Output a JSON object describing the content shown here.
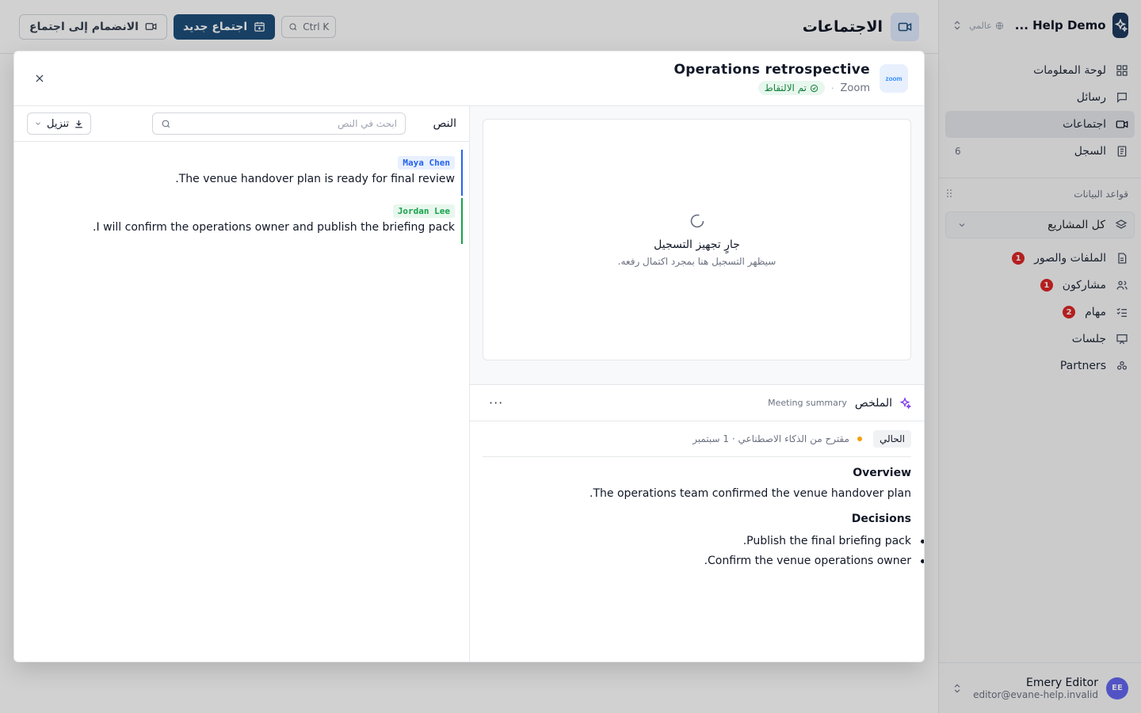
{
  "workspace": {
    "name": "Help Demo ...",
    "scope": "عالمي"
  },
  "sidebar": {
    "nav": [
      {
        "label": "لوحة المعلومات",
        "icon": "dashboard-icon"
      },
      {
        "label": "رسائل",
        "icon": "message-icon"
      },
      {
        "label": "اجتماعات",
        "icon": "video-icon",
        "active": true
      },
      {
        "label": "السجل",
        "icon": "log-icon",
        "count": "6"
      }
    ],
    "databases_title": "قواعد البيانات",
    "projects_label": "كل المشاريع",
    "db_items": [
      {
        "label": "الملفات والصور",
        "badge": "1",
        "icon": "file-icon"
      },
      {
        "label": "مشاركون",
        "badge": "1",
        "icon": "users-icon"
      },
      {
        "label": "مهام",
        "badge": "2",
        "icon": "tasks-icon"
      },
      {
        "label": "جلسات",
        "badge": "",
        "icon": "presentation-icon"
      },
      {
        "label": "Partners",
        "badge": "",
        "icon": "partners-icon"
      }
    ],
    "user": {
      "initials": "EE",
      "name": "Emery Editor",
      "email": "editor@evane-help.invalid"
    }
  },
  "topbar": {
    "title": "الاجتماعات",
    "shortcut": "Ctrl K",
    "new_meeting": "اجتماع جديد",
    "join_meeting": "الانضمام إلى اجتماع"
  },
  "modal": {
    "title": "Operations retrospective",
    "provider": "Zoom",
    "provider_logo": "zoom",
    "status": "تم الالتقاط",
    "recording": {
      "title": "جارٍ تجهيز التسجيل",
      "subtitle": "سيظهر التسجيل هنا بمجرد اكتمال رفعه."
    },
    "summary": {
      "title": "الملخص",
      "subtitle": "Meeting summary",
      "version_label": "الحالي",
      "version_meta": "مقترح من الذكاء الاصطناعي · 1 سبتمبر",
      "overview_heading": "Overview",
      "overview_text": "The operations team confirmed the venue handover plan.",
      "decisions_heading": "Decisions",
      "decisions": [
        "Publish the final briefing pack.",
        "Confirm the venue operations owner."
      ]
    },
    "transcript": {
      "title": "النص",
      "search_placeholder": "ابحث في النص",
      "download_label": "تنزيل",
      "segments": [
        {
          "speaker": "Maya Chen",
          "text": "The venue handover plan is ready for final review.",
          "color": "#2563eb",
          "bg": "#e8f0fe"
        },
        {
          "speaker": "Jordan Lee",
          "text": "I will confirm the operations owner and publish the briefing pack.",
          "color": "#16a34a",
          "bg": "#e8f7ee"
        }
      ]
    }
  },
  "colors": {
    "accent": "#1e4f7a",
    "badge": "#dc2626",
    "captured": "#15803d"
  }
}
